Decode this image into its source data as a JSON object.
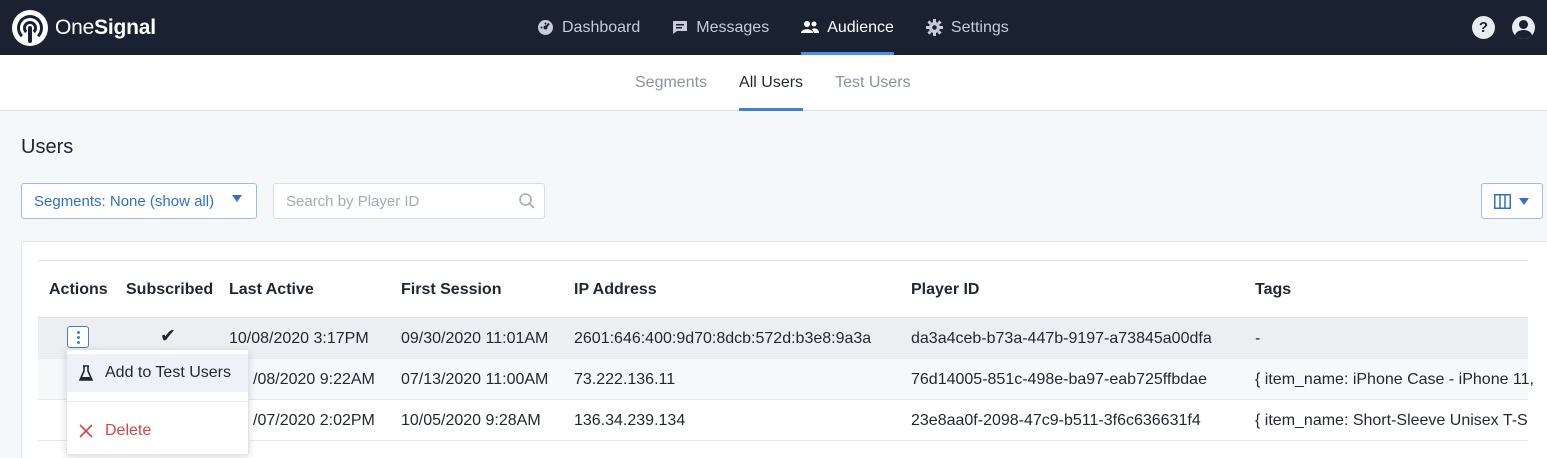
{
  "app": {
    "logo_one": "One",
    "logo_signal": "Signal"
  },
  "nav": {
    "items": [
      {
        "label": "Dashboard",
        "icon": "dashboard-icon",
        "active": false
      },
      {
        "label": "Messages",
        "icon": "message-icon",
        "active": false
      },
      {
        "label": "Audience",
        "icon": "users-icon",
        "active": true
      },
      {
        "label": "Settings",
        "icon": "gear-icon",
        "active": false
      }
    ],
    "help_label": "?"
  },
  "subtabs": [
    {
      "label": "Segments",
      "active": false
    },
    {
      "label": "All Users",
      "active": true
    },
    {
      "label": "Test Users",
      "active": false
    }
  ],
  "page": {
    "title": "Users"
  },
  "filters": {
    "segments_label": "Segments: None (show all)",
    "search_placeholder": "Search by Player ID"
  },
  "table": {
    "columns": [
      "Actions",
      "Subscribed",
      "Last Active",
      "First Session",
      "IP Address",
      "Player ID",
      "Tags"
    ],
    "rows": [
      {
        "subscribed": "✔",
        "last_active": "10/08/2020 3:17PM",
        "first_session": "09/30/2020 11:01AM",
        "ip": "2601:646:400:9d70:8dcb:572d:b3e8:9a3a",
        "player_id": "da3a4ceb-b73a-447b-9197-a73845a00dfa",
        "tags": "-"
      },
      {
        "subscribed": "",
        "last_active": "/08/2020 9:22AM",
        "first_session": "07/13/2020 11:00AM",
        "ip": "73.222.136.11",
        "player_id": "76d14005-851c-498e-ba97-eab725ffbdae",
        "tags": "{ item_name: iPhone Case - iPhone 11,"
      },
      {
        "subscribed": "",
        "last_active": "/07/2020 2:02PM",
        "first_session": "10/05/2020 9:28AM",
        "ip": "136.34.239.134",
        "player_id": "23e8aa0f-2098-47c9-b511-3f6c636631f4",
        "tags": "{ item_name: Short-Sleeve Unisex T-S"
      }
    ]
  },
  "menu": {
    "add_label": "Add to Test Users",
    "delete_label": "Delete"
  },
  "colors": {
    "nav_bg": "#1a2130",
    "accent": "#3f7fd9",
    "danger": "#d94343"
  }
}
